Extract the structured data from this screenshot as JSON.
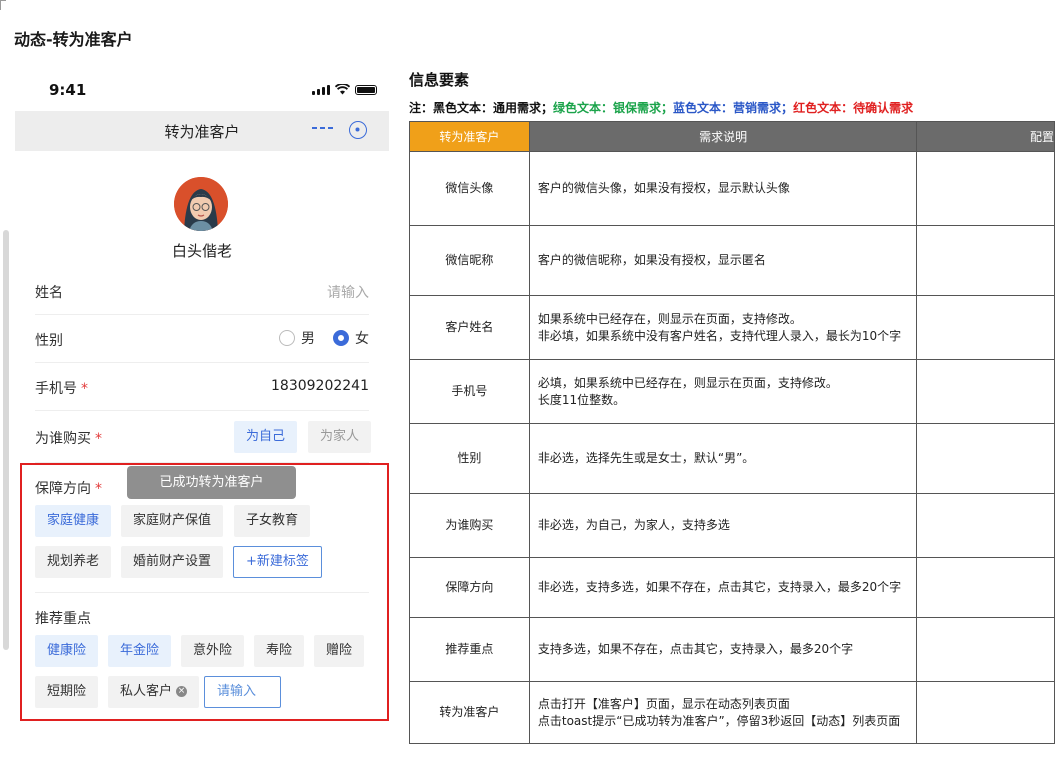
{
  "page_title": "动态-转为准客户",
  "phone": {
    "status_time": "9:41",
    "nav_title": "转为准客户",
    "nickname": "白头偕老",
    "fields": {
      "name": {
        "label": "姓名",
        "placeholder": "请输入"
      },
      "gender": {
        "label": "性别",
        "options": [
          "男",
          "女"
        ],
        "selected": "女"
      },
      "phone": {
        "label": "手机号",
        "required": "*",
        "value": "18309202241"
      },
      "buy_for": {
        "label": "为谁购买",
        "required": "*",
        "options": [
          "为自己",
          "为家人"
        ],
        "selected": [
          "为自己"
        ]
      }
    },
    "protection": {
      "label": "保障方向",
      "required": "*",
      "tags": [
        "家庭健康",
        "家庭财产保值",
        "子女教育",
        "规划养老",
        "婚前财产设置"
      ],
      "selected": [
        "家庭健康"
      ],
      "new_tag": "+新建标签"
    },
    "recommend": {
      "label": "推荐重点",
      "tags": [
        "健康险",
        "年金险",
        "意外险",
        "寿险",
        "赠险",
        "短期险",
        "私人客户"
      ],
      "selected": [
        "健康险",
        "年金险"
      ],
      "input_placeholder": "请输入"
    },
    "toast": "已成功转为准客户"
  },
  "info": {
    "title": "信息要素",
    "legend": {
      "prefix": "注：",
      "black": "黑色文本：通用需求；",
      "green": "绿色文本：银保需求；",
      "blue": "蓝色文本：营销需求；",
      "red": "红色文本：待确认需求"
    },
    "table": {
      "headers": [
        "转为准客户",
        "需求说明",
        "配置"
      ],
      "rows": [
        {
          "key": "微信头像",
          "desc": "客户的微信头像，如果没有授权，显示默认头像"
        },
        {
          "key": "微信昵称",
          "desc": "客户的微信昵称，如果没有授权，显示匿名"
        },
        {
          "key": "客户姓名",
          "desc": "如果系统中已经存在，则显示在页面，支持修改。\n非必填，如果系统中没有客户姓名，支持代理人录入，最长为10个字"
        },
        {
          "key": "手机号",
          "desc": "必填，如果系统中已经存在，则显示在页面，支持修改。\n长度11位整数。"
        },
        {
          "key": "性别",
          "desc": "非必选，选择先生或是女士，默认“男”。"
        },
        {
          "key": "为谁购买",
          "desc": "非必选，为自己，为家人，支持多选"
        },
        {
          "key": "保障方向",
          "desc": "非必选，支持多选，如果不存在，点击其它，支持录入，最多20个字"
        },
        {
          "key": "推荐重点",
          "desc": "支持多选，如果不存在，点击其它，支持录入，最多20个字"
        },
        {
          "key": "转为准客户",
          "desc": "点击打开【准客户】页面，显示在动态列表页面\n点击toast提示“已成功转为准客户”，停留3秒返回【动态】列表页面"
        }
      ]
    }
  }
}
